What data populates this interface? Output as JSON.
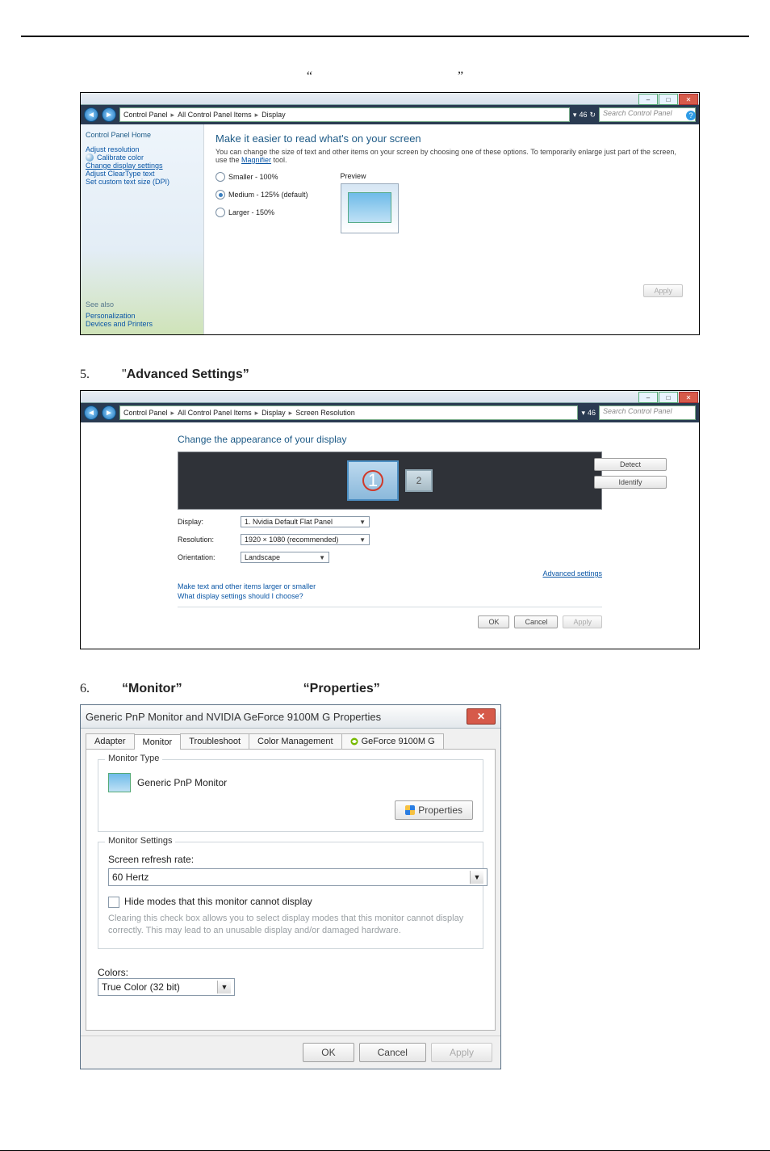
{
  "marks": {
    "lq": "“",
    "rq": "”"
  },
  "steps": {
    "s5": {
      "num": "5.",
      "label": "Advanced Settings”"
    },
    "s6": {
      "num": "6.",
      "m": "“Monitor”",
      "p": "“Properties”"
    }
  },
  "win1": {
    "titlebtns": {
      "min": "–",
      "max": "□",
      "close": "✕"
    },
    "breadcrumb": [
      "Control Panel",
      "All Control Panel Items",
      "Display"
    ],
    "search_ph": "Search Control Panel",
    "refresh": "↻",
    "sep46": "46",
    "help": "?",
    "sidebar": {
      "home": "Control Panel Home",
      "items": [
        "Adjust resolution",
        "Calibrate color",
        "Change display settings",
        "Adjust ClearType text",
        "Set custom text size (DPI)"
      ],
      "seealso_h": "See also",
      "seealso": [
        "Personalization",
        "Devices and Printers"
      ]
    },
    "main": {
      "heading": "Make it easier to read what's on your screen",
      "desc1": "You can change the size of text and other items on your screen by choosing one of these options. To temporarily enlarge just part of the screen, use the ",
      "desc_link": "Magnifier",
      "desc2": " tool.",
      "radios": [
        {
          "label": "Smaller - 100%",
          "on": false
        },
        {
          "label": "Medium - 125% (default)",
          "on": true
        },
        {
          "label": "Larger - 150%",
          "on": false
        }
      ],
      "preview": "Preview",
      "apply": "Apply"
    }
  },
  "win2": {
    "breadcrumb": [
      "Control Panel",
      "All Control Panel Items",
      "Display",
      "Screen Resolution"
    ],
    "search_ph": "Search Control Panel",
    "heading": "Change the appearance of your display",
    "detect": "Detect",
    "identify": "Identify",
    "mon1": "1",
    "mon2": "2",
    "rows": {
      "display_l": "Display:",
      "display_v": "1. Nvidia Default Flat Panel",
      "res_l": "Resolution:",
      "res_v": "1920 × 1080 (recommended)",
      "orient_l": "Orientation:",
      "orient_v": "Landscape"
    },
    "adv": "Advanced settings",
    "q1": "Make text and other items larger or smaller",
    "q2": "What display settings should I choose?",
    "ok": "OK",
    "cancel": "Cancel",
    "apply": "Apply"
  },
  "dlg": {
    "title": "Generic PnP Monitor and NVIDIA GeForce 9100M G   Properties",
    "close": "✕",
    "tabs": [
      "Adapter",
      "Monitor",
      "Troubleshoot",
      "Color Management",
      "GeForce 9100M G"
    ],
    "type_h": "Monitor Type",
    "type_v": "Generic PnP Monitor",
    "prop_btn": "Properties",
    "settings_h": "Monitor Settings",
    "rate_l": "Screen refresh rate:",
    "rate_v": "60 Hertz",
    "hide": "Hide modes that this monitor cannot display",
    "hide_desc": "Clearing this check box allows you to select display modes that this monitor cannot display correctly. This may lead to an unusable display and/or damaged hardware.",
    "colors_l": "Colors:",
    "colors_v": "True Color (32 bit)",
    "ok": "OK",
    "cancel": "Cancel",
    "apply": "Apply"
  }
}
